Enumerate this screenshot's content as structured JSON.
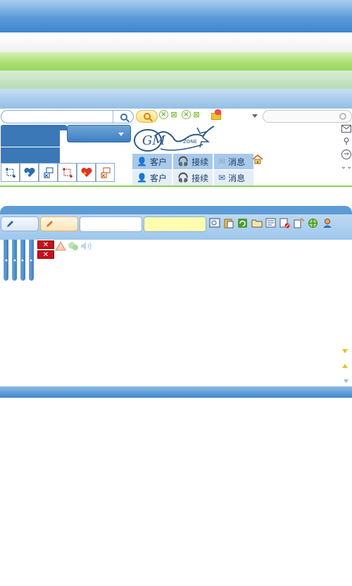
{
  "search": {
    "placeholder": "",
    "value": ""
  },
  "right_search": {
    "placeholder": ""
  },
  "logo": {
    "text": "GM",
    "subtext": "ZONE"
  },
  "menu_rows": [
    [
      {
        "label": "客户",
        "icon": "user-icon"
      },
      {
        "label": "接续",
        "icon": "headset-icon"
      },
      {
        "label": "消息",
        "icon": "mail-icon"
      }
    ],
    [
      {
        "label": "客户",
        "icon": "user-icon"
      },
      {
        "label": "接续",
        "icon": "headset-icon"
      },
      {
        "label": "消息",
        "icon": "mail-icon"
      }
    ]
  ],
  "toolbar_icons": [
    "add-frame-icon",
    "add-heart-icon",
    "transfer-icon",
    "add-frame-icon",
    "add-heart-icon",
    "transfer-icon"
  ],
  "panel": {
    "input1": "",
    "input2": ""
  },
  "colors": {
    "primary": "#3f86cf",
    "accent_green": "#8cd35a",
    "warning_red": "#c8101a"
  }
}
